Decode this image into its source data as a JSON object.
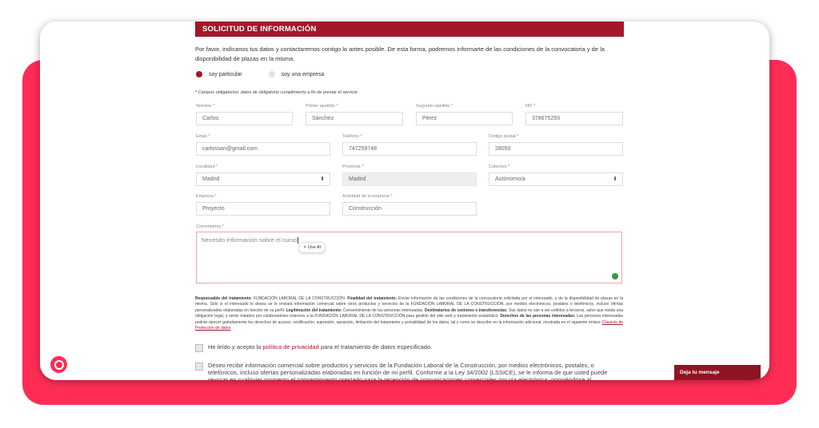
{
  "header": {
    "title": "SOLICITUD DE INFORMACIÓN"
  },
  "intro": "Por favor, indícanos tus datos y contactaremos contigo lo antes posible. De esta forma, podremos informarte de las condiciones de la convocatoria y de la disponibilidad de plazas en la misma.",
  "radios": {
    "particular": "soy particular",
    "empresa": "soy una empresa"
  },
  "required_note": "* Campos obligatorios: datos de obligatorio cumplimiento a fin de prestar el servicio",
  "fields": {
    "nombre": {
      "label": "Nombre *",
      "value": "Carlos"
    },
    "apellido1": {
      "label": "Primer apellido *",
      "value": "Sánchez"
    },
    "apellido2": {
      "label": "Segundo apellido *",
      "value": "Pérez"
    },
    "nif": {
      "label": "NIF *",
      "value": "37867529​3"
    },
    "email": {
      "label": "Email *",
      "value": "carlossan@gmail.com"
    },
    "telefono": {
      "label": "Teléfono *",
      "value": "747259748"
    },
    "cp": {
      "label": "Código postal *",
      "value": "28050"
    },
    "localidad": {
      "label": "Localidad *",
      "value": "Madrid"
    },
    "provincia": {
      "label": "Provincia *",
      "value": "Madrid"
    },
    "colectivo": {
      "label": "Colectivo *",
      "value": "Autónomo/a"
    },
    "empresa": {
      "label": "Empresa *",
      "value": "Proyecto"
    },
    "actividad": {
      "label": "Actividad de la empresa *",
      "value": "Construcción"
    },
    "comentarios": {
      "label": "Comentarios *",
      "value": "Necesito información sobre el curso"
    }
  },
  "use_ai": "Use AI",
  "legal": {
    "t1": "Responsable del tratamiento:",
    "p1": " FUNDACIÓN LABORAL DE LA CONSTRUCCIÓN. ",
    "t2": "Finalidad del tratamiento:",
    "p2": " Enviar información de las condiciones de la convocatoria solicitada por el interesado, y de la disponibilidad de plazas en la misma. Sólo si el interesado lo desea se le enviará información comercial sobre otros productos y servicios de la FUNDACIÓN LABORAL DE LA CONSTRUCCIÓN, por medios electrónicos, postales o telefónicos, incluso ofertas personalizadas elaboradas en función de su perfil. ",
    "t3": "Legitimación del tratamiento:",
    "p3": " Consentimiento de las personas interesadas. ",
    "t4": "Destinatarios de cesiones e transferencias:",
    "p4": " Sus datos no van a ser cedidos a terceros, salvo que exista una obligación legal, y serán tratados por colaboradores externos a la FUNDACIÓN LABORAL DE LA CONSTRUCCIÓN para gestión del sitio web y tratamiento estadístico. ",
    "t5": "Derechos de las personas interesadas:",
    "p5": " Las personas interesadas podrán ejercer gratuitamente los derechos de acceso, rectificación, supresión, oposición, limitación del tratamiento y portabilidad de los datos, tal y como se describe en la información adicional, mostrada en el siguiente enlace ",
    "link": "Cláusula de Protección de datos"
  },
  "privacy": {
    "pre": "He leído y acepto la ",
    "link": "política de privacidad",
    "post": " para el tratamiento de datos especificado."
  },
  "marketing": "Deseo recibir información comercial sobre productos y servicios de la Fundación Laboral de la Construcción, por medios electrónicos, postales, o telefónicos, incluso ofertas personalizadas elaboradas en función de mi perfil. Conforme a la Ley 34/2002 (LSSICE), se le informa de que usted puede revocar en cualquier momento el consentimiento prestado para la recepción de comunicaciones comerciales por vía electrónica, oponiéndose al tratamiento de sus datos.",
  "chat": {
    "label": "Deja tu mensaje"
  },
  "colors": {
    "brand": "#a3172b",
    "accent": "#ff2d55"
  }
}
